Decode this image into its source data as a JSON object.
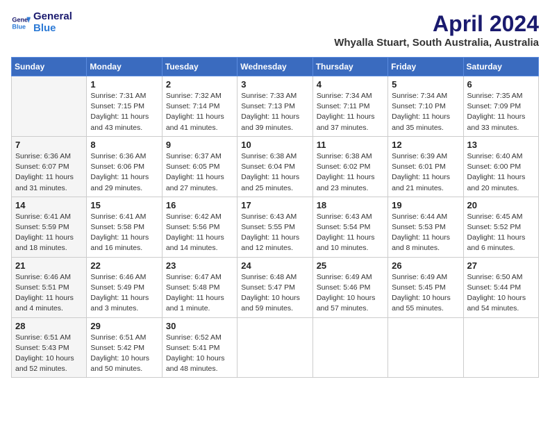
{
  "logo": {
    "line1": "General",
    "line2": "Blue"
  },
  "title": "April 2024",
  "location": "Whyalla Stuart, South Australia, Australia",
  "days_of_week": [
    "Sunday",
    "Monday",
    "Tuesday",
    "Wednesday",
    "Thursday",
    "Friday",
    "Saturday"
  ],
  "weeks": [
    [
      {
        "day": "",
        "info": ""
      },
      {
        "day": "1",
        "info": "Sunrise: 7:31 AM\nSunset: 7:15 PM\nDaylight: 11 hours\nand 43 minutes."
      },
      {
        "day": "2",
        "info": "Sunrise: 7:32 AM\nSunset: 7:14 PM\nDaylight: 11 hours\nand 41 minutes."
      },
      {
        "day": "3",
        "info": "Sunrise: 7:33 AM\nSunset: 7:13 PM\nDaylight: 11 hours\nand 39 minutes."
      },
      {
        "day": "4",
        "info": "Sunrise: 7:34 AM\nSunset: 7:11 PM\nDaylight: 11 hours\nand 37 minutes."
      },
      {
        "day": "5",
        "info": "Sunrise: 7:34 AM\nSunset: 7:10 PM\nDaylight: 11 hours\nand 35 minutes."
      },
      {
        "day": "6",
        "info": "Sunrise: 7:35 AM\nSunset: 7:09 PM\nDaylight: 11 hours\nand 33 minutes."
      }
    ],
    [
      {
        "day": "7",
        "info": "Sunrise: 6:36 AM\nSunset: 6:07 PM\nDaylight: 11 hours\nand 31 minutes."
      },
      {
        "day": "8",
        "info": "Sunrise: 6:36 AM\nSunset: 6:06 PM\nDaylight: 11 hours\nand 29 minutes."
      },
      {
        "day": "9",
        "info": "Sunrise: 6:37 AM\nSunset: 6:05 PM\nDaylight: 11 hours\nand 27 minutes."
      },
      {
        "day": "10",
        "info": "Sunrise: 6:38 AM\nSunset: 6:04 PM\nDaylight: 11 hours\nand 25 minutes."
      },
      {
        "day": "11",
        "info": "Sunrise: 6:38 AM\nSunset: 6:02 PM\nDaylight: 11 hours\nand 23 minutes."
      },
      {
        "day": "12",
        "info": "Sunrise: 6:39 AM\nSunset: 6:01 PM\nDaylight: 11 hours\nand 21 minutes."
      },
      {
        "day": "13",
        "info": "Sunrise: 6:40 AM\nSunset: 6:00 PM\nDaylight: 11 hours\nand 20 minutes."
      }
    ],
    [
      {
        "day": "14",
        "info": "Sunrise: 6:41 AM\nSunset: 5:59 PM\nDaylight: 11 hours\nand 18 minutes."
      },
      {
        "day": "15",
        "info": "Sunrise: 6:41 AM\nSunset: 5:58 PM\nDaylight: 11 hours\nand 16 minutes."
      },
      {
        "day": "16",
        "info": "Sunrise: 6:42 AM\nSunset: 5:56 PM\nDaylight: 11 hours\nand 14 minutes."
      },
      {
        "day": "17",
        "info": "Sunrise: 6:43 AM\nSunset: 5:55 PM\nDaylight: 11 hours\nand 12 minutes."
      },
      {
        "day": "18",
        "info": "Sunrise: 6:43 AM\nSunset: 5:54 PM\nDaylight: 11 hours\nand 10 minutes."
      },
      {
        "day": "19",
        "info": "Sunrise: 6:44 AM\nSunset: 5:53 PM\nDaylight: 11 hours\nand 8 minutes."
      },
      {
        "day": "20",
        "info": "Sunrise: 6:45 AM\nSunset: 5:52 PM\nDaylight: 11 hours\nand 6 minutes."
      }
    ],
    [
      {
        "day": "21",
        "info": "Sunrise: 6:46 AM\nSunset: 5:51 PM\nDaylight: 11 hours\nand 4 minutes."
      },
      {
        "day": "22",
        "info": "Sunrise: 6:46 AM\nSunset: 5:49 PM\nDaylight: 11 hours\nand 3 minutes."
      },
      {
        "day": "23",
        "info": "Sunrise: 6:47 AM\nSunset: 5:48 PM\nDaylight: 11 hours\nand 1 minute."
      },
      {
        "day": "24",
        "info": "Sunrise: 6:48 AM\nSunset: 5:47 PM\nDaylight: 10 hours\nand 59 minutes."
      },
      {
        "day": "25",
        "info": "Sunrise: 6:49 AM\nSunset: 5:46 PM\nDaylight: 10 hours\nand 57 minutes."
      },
      {
        "day": "26",
        "info": "Sunrise: 6:49 AM\nSunset: 5:45 PM\nDaylight: 10 hours\nand 55 minutes."
      },
      {
        "day": "27",
        "info": "Sunrise: 6:50 AM\nSunset: 5:44 PM\nDaylight: 10 hours\nand 54 minutes."
      }
    ],
    [
      {
        "day": "28",
        "info": "Sunrise: 6:51 AM\nSunset: 5:43 PM\nDaylight: 10 hours\nand 52 minutes."
      },
      {
        "day": "29",
        "info": "Sunrise: 6:51 AM\nSunset: 5:42 PM\nDaylight: 10 hours\nand 50 minutes."
      },
      {
        "day": "30",
        "info": "Sunrise: 6:52 AM\nSunset: 5:41 PM\nDaylight: 10 hours\nand 48 minutes."
      },
      {
        "day": "",
        "info": ""
      },
      {
        "day": "",
        "info": ""
      },
      {
        "day": "",
        "info": ""
      },
      {
        "day": "",
        "info": ""
      }
    ]
  ]
}
